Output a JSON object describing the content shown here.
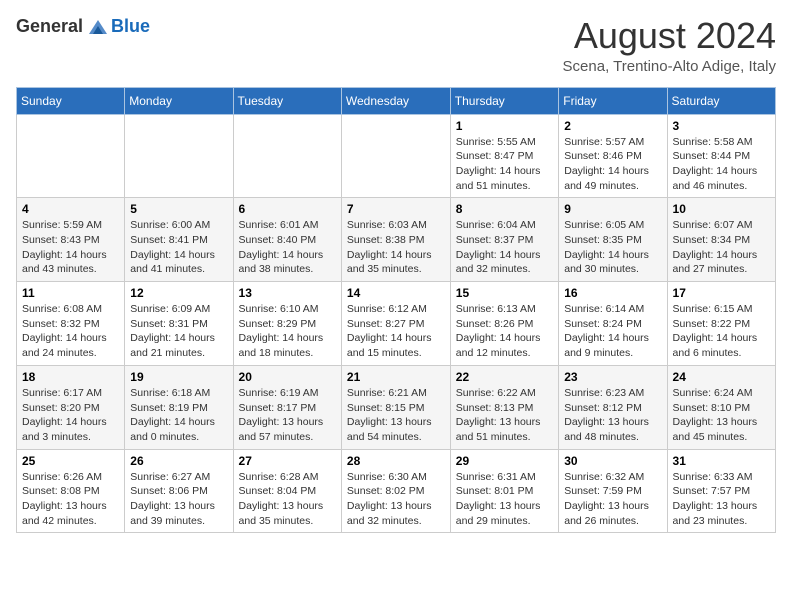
{
  "header": {
    "logo_general": "General",
    "logo_blue": "Blue",
    "month_year": "August 2024",
    "location": "Scena, Trentino-Alto Adige, Italy"
  },
  "days_of_week": [
    "Sunday",
    "Monday",
    "Tuesday",
    "Wednesday",
    "Thursday",
    "Friday",
    "Saturday"
  ],
  "weeks": [
    [
      {
        "day": "",
        "info": ""
      },
      {
        "day": "",
        "info": ""
      },
      {
        "day": "",
        "info": ""
      },
      {
        "day": "",
        "info": ""
      },
      {
        "day": "1",
        "info": "Sunrise: 5:55 AM\nSunset: 8:47 PM\nDaylight: 14 hours\nand 51 minutes."
      },
      {
        "day": "2",
        "info": "Sunrise: 5:57 AM\nSunset: 8:46 PM\nDaylight: 14 hours\nand 49 minutes."
      },
      {
        "day": "3",
        "info": "Sunrise: 5:58 AM\nSunset: 8:44 PM\nDaylight: 14 hours\nand 46 minutes."
      }
    ],
    [
      {
        "day": "4",
        "info": "Sunrise: 5:59 AM\nSunset: 8:43 PM\nDaylight: 14 hours\nand 43 minutes."
      },
      {
        "day": "5",
        "info": "Sunrise: 6:00 AM\nSunset: 8:41 PM\nDaylight: 14 hours\nand 41 minutes."
      },
      {
        "day": "6",
        "info": "Sunrise: 6:01 AM\nSunset: 8:40 PM\nDaylight: 14 hours\nand 38 minutes."
      },
      {
        "day": "7",
        "info": "Sunrise: 6:03 AM\nSunset: 8:38 PM\nDaylight: 14 hours\nand 35 minutes."
      },
      {
        "day": "8",
        "info": "Sunrise: 6:04 AM\nSunset: 8:37 PM\nDaylight: 14 hours\nand 32 minutes."
      },
      {
        "day": "9",
        "info": "Sunrise: 6:05 AM\nSunset: 8:35 PM\nDaylight: 14 hours\nand 30 minutes."
      },
      {
        "day": "10",
        "info": "Sunrise: 6:07 AM\nSunset: 8:34 PM\nDaylight: 14 hours\nand 27 minutes."
      }
    ],
    [
      {
        "day": "11",
        "info": "Sunrise: 6:08 AM\nSunset: 8:32 PM\nDaylight: 14 hours\nand 24 minutes."
      },
      {
        "day": "12",
        "info": "Sunrise: 6:09 AM\nSunset: 8:31 PM\nDaylight: 14 hours\nand 21 minutes."
      },
      {
        "day": "13",
        "info": "Sunrise: 6:10 AM\nSunset: 8:29 PM\nDaylight: 14 hours\nand 18 minutes."
      },
      {
        "day": "14",
        "info": "Sunrise: 6:12 AM\nSunset: 8:27 PM\nDaylight: 14 hours\nand 15 minutes."
      },
      {
        "day": "15",
        "info": "Sunrise: 6:13 AM\nSunset: 8:26 PM\nDaylight: 14 hours\nand 12 minutes."
      },
      {
        "day": "16",
        "info": "Sunrise: 6:14 AM\nSunset: 8:24 PM\nDaylight: 14 hours\nand 9 minutes."
      },
      {
        "day": "17",
        "info": "Sunrise: 6:15 AM\nSunset: 8:22 PM\nDaylight: 14 hours\nand 6 minutes."
      }
    ],
    [
      {
        "day": "18",
        "info": "Sunrise: 6:17 AM\nSunset: 8:20 PM\nDaylight: 14 hours\nand 3 minutes."
      },
      {
        "day": "19",
        "info": "Sunrise: 6:18 AM\nSunset: 8:19 PM\nDaylight: 14 hours\nand 0 minutes."
      },
      {
        "day": "20",
        "info": "Sunrise: 6:19 AM\nSunset: 8:17 PM\nDaylight: 13 hours\nand 57 minutes."
      },
      {
        "day": "21",
        "info": "Sunrise: 6:21 AM\nSunset: 8:15 PM\nDaylight: 13 hours\nand 54 minutes."
      },
      {
        "day": "22",
        "info": "Sunrise: 6:22 AM\nSunset: 8:13 PM\nDaylight: 13 hours\nand 51 minutes."
      },
      {
        "day": "23",
        "info": "Sunrise: 6:23 AM\nSunset: 8:12 PM\nDaylight: 13 hours\nand 48 minutes."
      },
      {
        "day": "24",
        "info": "Sunrise: 6:24 AM\nSunset: 8:10 PM\nDaylight: 13 hours\nand 45 minutes."
      }
    ],
    [
      {
        "day": "25",
        "info": "Sunrise: 6:26 AM\nSunset: 8:08 PM\nDaylight: 13 hours\nand 42 minutes."
      },
      {
        "day": "26",
        "info": "Sunrise: 6:27 AM\nSunset: 8:06 PM\nDaylight: 13 hours\nand 39 minutes."
      },
      {
        "day": "27",
        "info": "Sunrise: 6:28 AM\nSunset: 8:04 PM\nDaylight: 13 hours\nand 35 minutes."
      },
      {
        "day": "28",
        "info": "Sunrise: 6:30 AM\nSunset: 8:02 PM\nDaylight: 13 hours\nand 32 minutes."
      },
      {
        "day": "29",
        "info": "Sunrise: 6:31 AM\nSunset: 8:01 PM\nDaylight: 13 hours\nand 29 minutes."
      },
      {
        "day": "30",
        "info": "Sunrise: 6:32 AM\nSunset: 7:59 PM\nDaylight: 13 hours\nand 26 minutes."
      },
      {
        "day": "31",
        "info": "Sunrise: 6:33 AM\nSunset: 7:57 PM\nDaylight: 13 hours\nand 23 minutes."
      }
    ]
  ]
}
